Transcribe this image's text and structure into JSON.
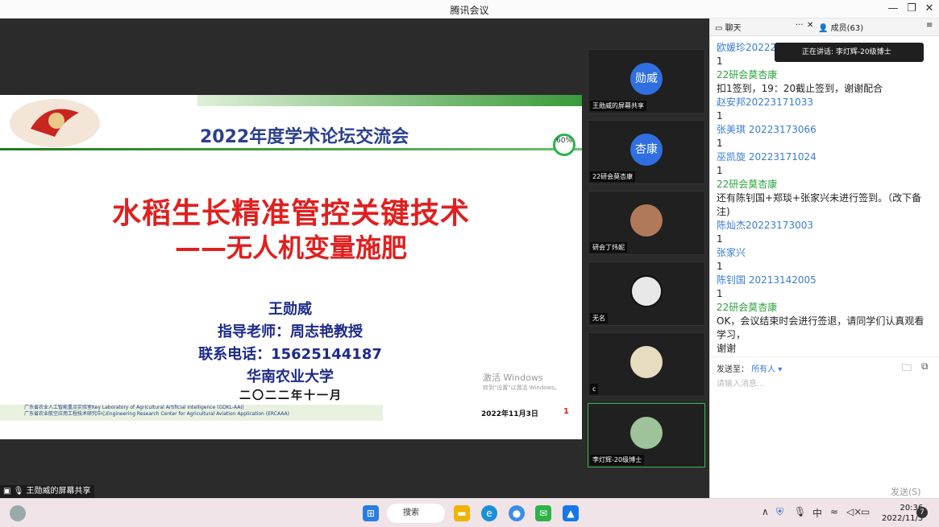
{
  "window": {
    "title": "腾讯会议",
    "minimize": "—",
    "restore": "❐",
    "close": "✕"
  },
  "slide": {
    "subtitle": "2022年度学术论坛交流会",
    "badge": "60%",
    "title_line1": "水稻生长精准管控关键技术",
    "title_line2": "——无人机变量施肥",
    "presenter": "王勋威",
    "advisor": "指导老师：周志艳教授",
    "phone": "联系电话：15625144187",
    "university": "华南农业大学",
    "date": "二〇二二年十一月",
    "footer_line1": "广东省农业人工智能重点实验室Key Laboratory of Agricultural Artificial Intelligence (GDKL-AAI)",
    "footer_line2": "广东省农业航空应用工程技术研究中心Engineering Research Center for Agricultural Aviation Application (ERCAAA)",
    "footer_date": "2022年11月3日",
    "page_number": "1",
    "watermark_line1": "激活 Windows",
    "watermark_line2": "转到\"设置\"以激活 Windows。"
  },
  "share_label": "王勋威的屏幕共享",
  "videos": [
    {
      "avatar_text": "勋威",
      "avatar_color": "#2f6fe0",
      "name": "王勋威的屏幕共享"
    },
    {
      "avatar_text": "杏康",
      "avatar_color": "#2f6fe0",
      "name": "22研会莫杏康"
    },
    {
      "avatar_text": "",
      "avatar_color": "#b07a5a",
      "name": "研会丁炜妮"
    },
    {
      "avatar_text": "",
      "avatar_color": "#e8e8e8",
      "name": "无名"
    },
    {
      "avatar_text": "",
      "avatar_color": "#e8dcc0",
      "name": "c"
    },
    {
      "avatar_text": "",
      "avatar_color": "#9ec39a",
      "name": "李灯辉-20级博士"
    }
  ],
  "chat": {
    "tab_chat": "聊天",
    "tab_more": "···",
    "tab_close": "✕",
    "tab_members": "成员(63)",
    "tab_menu": "≡",
    "speaking": "正在讲话: 李灯辉-20级博士",
    "messages": [
      {
        "type": "n",
        "text": "欧媛珍20222171"
      },
      {
        "type": "t",
        "text": "1"
      },
      {
        "type": "g",
        "text": "22研会莫杏康"
      },
      {
        "type": "t",
        "text": "扣1签到，19：20截止签到，谢谢配合"
      },
      {
        "type": "n",
        "text": "赵安邦20223171033"
      },
      {
        "type": "t",
        "text": "1"
      },
      {
        "type": "n",
        "text": "张美琪 20223173066"
      },
      {
        "type": "t",
        "text": "1"
      },
      {
        "type": "n",
        "text": "巫凯旋 20223171024"
      },
      {
        "type": "t",
        "text": "1"
      },
      {
        "type": "g",
        "text": "22研会莫杏康"
      },
      {
        "type": "t",
        "text": "还有陈钊国+郑琰+张家兴未进行签到。（改下备注)"
      },
      {
        "type": "n",
        "text": "陈灿杰20223173003"
      },
      {
        "type": "t",
        "text": "1"
      },
      {
        "type": "n",
        "text": "张家兴"
      },
      {
        "type": "t",
        "text": "1"
      },
      {
        "type": "n",
        "text": "陈钊国 20213142005"
      },
      {
        "type": "t",
        "text": "1"
      },
      {
        "type": "g",
        "text": "22研会莫杏康"
      },
      {
        "type": "t",
        "text": "OK，会议结束时会进行签退，请同学们认真观看学习，"
      },
      {
        "type": "t",
        "text": "谢谢"
      }
    ],
    "send_to_label": "发送至：",
    "send_to_value": "所有人 ▾",
    "input_placeholder": "请输入消息...",
    "send_button": "发送(S)"
  },
  "taskbar": {
    "search": "搜索",
    "tray_ime": "中",
    "time": "20:36",
    "date": "2022/11/3",
    "notif": "7"
  }
}
